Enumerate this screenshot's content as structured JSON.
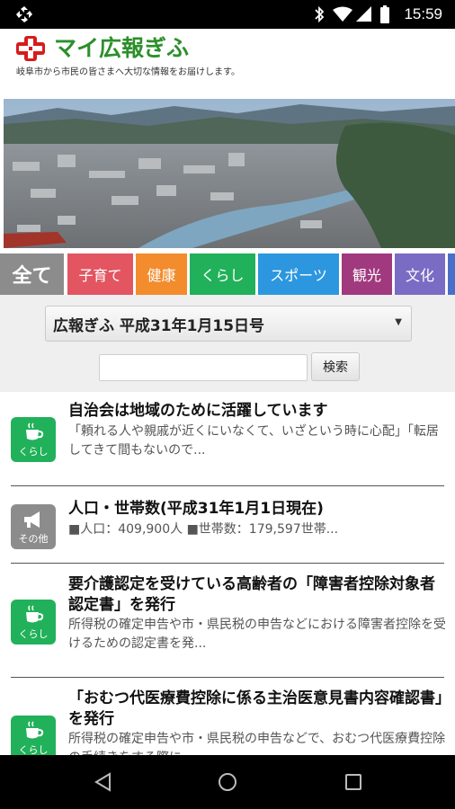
{
  "status_bar": {
    "time": "15:59",
    "icons": [
      "bluetooth-icon",
      "wifi-icon",
      "signal-icon",
      "battery-icon"
    ]
  },
  "header": {
    "title": "マイ広報ぎふ",
    "subtitle": "岐阜市から市民の皆さまへ大切な情報をお届けします。"
  },
  "tabs": [
    {
      "label": "全て",
      "color": "#8c8c8c"
    },
    {
      "label": "子育て",
      "color": "#e25561"
    },
    {
      "label": "健康",
      "color": "#f28c2d"
    },
    {
      "label": "くらし",
      "color": "#21b15a"
    },
    {
      "label": "スポーツ",
      "color": "#2c97de"
    },
    {
      "label": "観光",
      "color": "#a0397e"
    },
    {
      "label": "文化",
      "color": "#7a6bc4"
    }
  ],
  "filter": {
    "selected_issue": "広報ぎふ 平成31年1月15日号",
    "search_value": "",
    "search_button": "検索"
  },
  "articles": [
    {
      "category": "くらし",
      "category_color": "#21b15a",
      "icon": "teacup-icon",
      "title": "自治会は地域のために活躍しています",
      "snippet": "「頼れる人や親戚が近くにいなくて、いざという時に心配」「転居してきて間もないので..."
    },
    {
      "category": "その他",
      "category_color": "#8c8c8c",
      "icon": "megaphone-icon",
      "title": "人口・世帯数(平成31年1月1日現在)",
      "snippet": "■人口：409,900人 ■世帯数：179,597世帯..."
    },
    {
      "category": "くらし",
      "category_color": "#21b15a",
      "icon": "teacup-icon",
      "title": "要介護認定を受けている高齢者の「障害者控除対象者認定書」を発行",
      "snippet": "所得税の確定申告や市・県民税の申告などにおける障害者控除を受けるための認定書を発..."
    },
    {
      "category": "くらし",
      "category_color": "#21b15a",
      "icon": "teacup-icon",
      "title": "「おむつ代医療費控除に係る主治医意見書内容確認書」を発行",
      "snippet": "所得税の確定申告や市・県民税の申告などで、おむつ代医療費控除の手続きをする際に..."
    }
  ],
  "nav": [
    "back-icon",
    "home-icon",
    "recents-icon"
  ]
}
